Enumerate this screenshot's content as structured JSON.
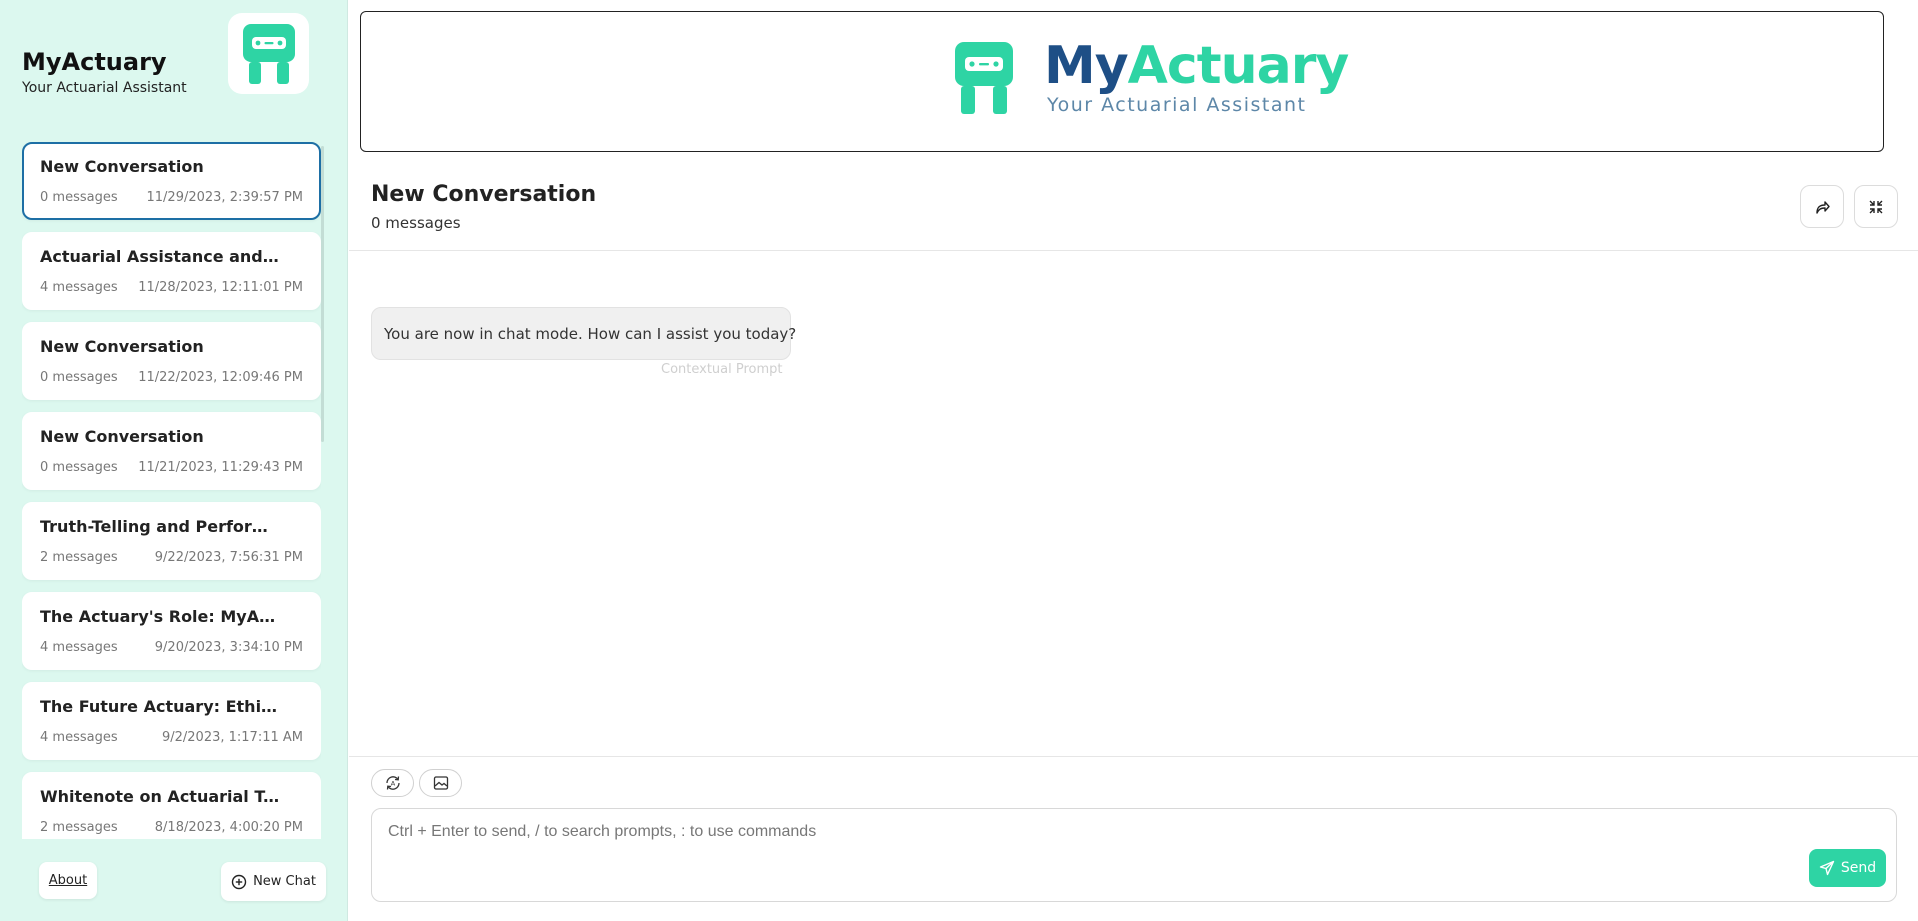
{
  "app": {
    "title": "MyActuary",
    "subtitle": "Your Actuarial Assistant"
  },
  "banner": {
    "title_part1": "My",
    "title_part2": "Actuary",
    "tagline": "Your Actuarial Assistant"
  },
  "colors": {
    "accent": "#2ed4a4",
    "brand_dark": "#1e4f86",
    "sidebar_bg": "#dcf8ef",
    "active_border": "#1d6fa5"
  },
  "conversations": [
    {
      "title": "New Conversation",
      "count": "0 messages",
      "time": "11/29/2023, 2:39:57 PM",
      "active": true
    },
    {
      "title": "Actuarial Assistance and Chatbot Introduction",
      "count": "4 messages",
      "time": "11/28/2023, 12:11:01 PM"
    },
    {
      "title": "New Conversation",
      "count": "0 messages",
      "time": "11/22/2023, 12:09:46 PM"
    },
    {
      "title": "New Conversation",
      "count": "0 messages",
      "time": "11/21/2023, 11:29:43 PM"
    },
    {
      "title": "Truth-Telling and Performance Discussion",
      "count": "2 messages",
      "time": "9/22/2023, 7:56:31 PM"
    },
    {
      "title": "The Actuary's Role: MyActuary Insights",
      "count": "4 messages",
      "time": "9/20/2023, 3:34:10 PM"
    },
    {
      "title": "The Future Actuary: Ethics, Bias and AI",
      "count": "4 messages",
      "time": "9/2/2023, 1:17:11 AM"
    },
    {
      "title": "Whitenote on Actuarial Topics",
      "count": "2 messages",
      "time": "8/18/2023, 4:00:20 PM"
    }
  ],
  "sidebar_footer": {
    "about_label": "About",
    "new_chat_label": "New Chat"
  },
  "chat": {
    "title": "New Conversation",
    "message_count": "0 messages",
    "bubble_text": "You are now in chat mode. How can I assist you today?",
    "bubble_note": "Contextual Prompt"
  },
  "composer": {
    "placeholder": "Ctrl + Enter to send, / to search prompts, : to use commands",
    "send_label": "Send"
  },
  "icons": {
    "logo": "robot-chat-icon",
    "share": "share-arrow-icon",
    "collapse": "collapse-icon",
    "model": "model-switch-icon",
    "image": "image-icon",
    "add": "plus-circle-icon",
    "send": "send-plane-icon"
  }
}
